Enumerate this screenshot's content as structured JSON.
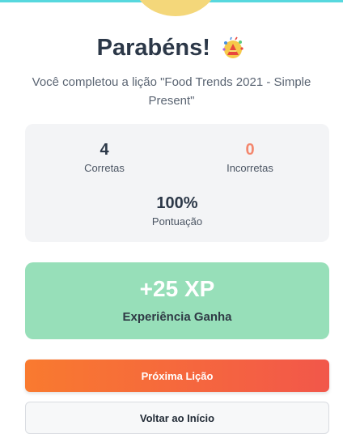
{
  "header": {
    "title": "Parabéns!",
    "celebration_icon": "party-popper-icon",
    "subtitle": "Você completou a lição \"Food Trends 2021 - Simple Present\""
  },
  "stats": {
    "correct": {
      "value": "4",
      "label": "Corretas"
    },
    "incorrect": {
      "value": "0",
      "label": "Incorretas"
    },
    "score": {
      "value": "100%",
      "label": "Pontuação"
    }
  },
  "xp": {
    "value": "+25 XP",
    "label": "Experiência Ganha"
  },
  "actions": {
    "next_label": "Próxima Lição",
    "home_label": "Voltar ao Início"
  },
  "colors": {
    "accent_top": "#57d8de",
    "xp_card": "#97dfb9",
    "incorrect": "#f3876e",
    "button_gradient_start": "#f97a2f",
    "button_gradient_end": "#f2574a"
  }
}
